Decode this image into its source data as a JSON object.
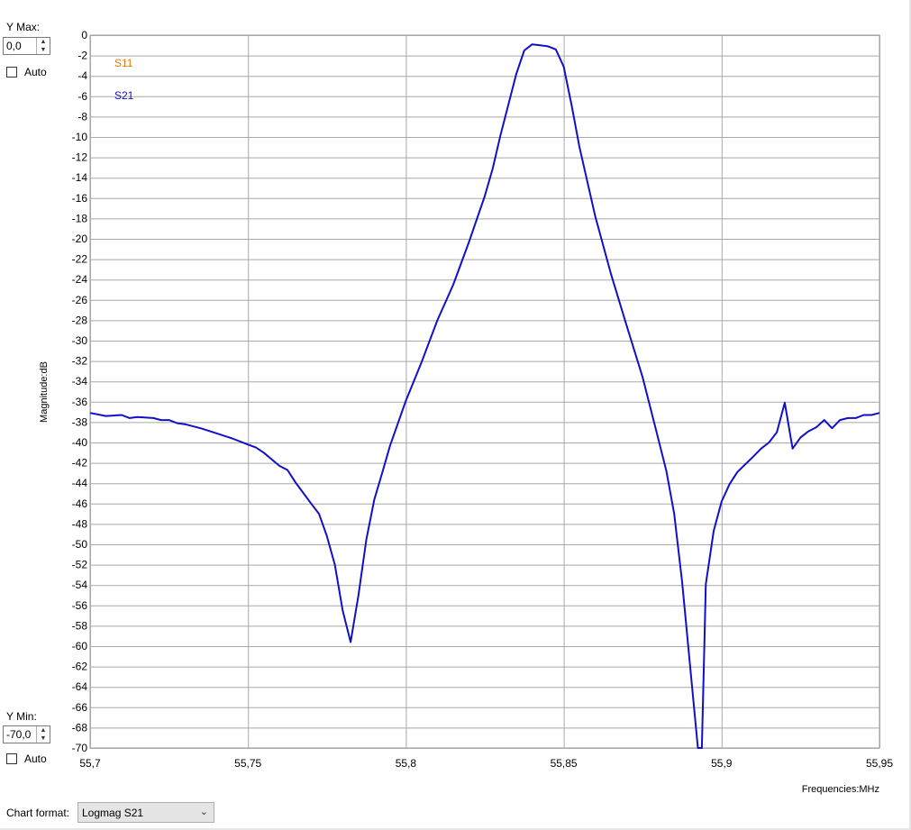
{
  "controls": {
    "ymax_label": "Y Max:",
    "ymax_value": "0,0",
    "ymax_auto_label": "Auto",
    "ymin_label": "Y Min:",
    "ymin_value": "-70,0",
    "ymin_auto_label": "Auto",
    "chart_format_label": "Chart format:",
    "chart_format_value": "Logmag S21"
  },
  "chart_data": {
    "type": "line",
    "xlabel": "Frequencies:MHz",
    "ylabel": "Magnitude:dB",
    "xlim": [
      55.7,
      55.95
    ],
    "ylim": [
      -70,
      0
    ],
    "x_ticks": [
      55.7,
      55.75,
      55.8,
      55.85,
      55.9,
      55.95
    ],
    "x_tick_labels": [
      "55,7",
      "55,75",
      "55,8",
      "55,85",
      "55,9",
      "55,95"
    ],
    "y_ticks": [
      0,
      -2,
      -4,
      -6,
      -8,
      -10,
      -12,
      -14,
      -16,
      -18,
      -20,
      -22,
      -24,
      -26,
      -28,
      -30,
      -32,
      -34,
      -36,
      -38,
      -40,
      -42,
      -44,
      -46,
      -48,
      -50,
      -52,
      -54,
      -56,
      -58,
      -60,
      -62,
      -64,
      -66,
      -68,
      -70
    ],
    "y_tick_labels": [
      "0",
      "-2",
      "-4",
      "-6",
      "-8",
      "-10",
      "-12",
      "-14",
      "-16",
      "-18",
      "-20",
      "-22",
      "-24",
      "-26",
      "-28",
      "-30",
      "-32",
      "-34",
      "-36",
      "-38",
      "-40",
      "-42",
      "-44",
      "-46",
      "-48",
      "-50",
      "-52",
      "-54",
      "-56",
      "-58",
      "-60",
      "-62",
      "-64",
      "-66",
      "-68",
      "-70"
    ],
    "grid": true,
    "legend_position": "top-left",
    "series": [
      {
        "name": "S11",
        "color": "#e07b00",
        "x": [],
        "y": []
      },
      {
        "name": "S21",
        "color": "#1010c8",
        "x": [
          55.7,
          55.705,
          55.71,
          55.7125,
          55.715,
          55.72,
          55.7225,
          55.725,
          55.7275,
          55.73,
          55.735,
          55.74,
          55.745,
          55.75,
          55.7525,
          55.755,
          55.76,
          55.7625,
          55.765,
          55.77,
          55.7725,
          55.775,
          55.7775,
          55.78,
          55.7825,
          55.785,
          55.7875,
          55.79,
          55.7925,
          55.795,
          55.8,
          55.805,
          55.81,
          55.815,
          55.82,
          55.825,
          55.8275,
          55.83,
          55.835,
          55.8375,
          55.84,
          55.8425,
          55.845,
          55.8475,
          55.85,
          55.8525,
          55.855,
          55.86,
          55.865,
          55.87,
          55.875,
          55.88,
          55.8825,
          55.885,
          55.8875,
          55.8925,
          55.89375,
          55.895,
          55.8975,
          55.9,
          55.9025,
          55.905,
          55.91,
          55.9125,
          55.915,
          55.9175,
          55.92,
          55.9225,
          55.925,
          55.9275,
          55.93,
          55.9325,
          55.935,
          55.9375,
          55.94,
          55.9425,
          55.945,
          55.9475,
          55.95
        ],
        "y": [
          -37.1,
          -37.4,
          -37.3,
          -37.6,
          -37.5,
          -37.6,
          -37.8,
          -37.8,
          -38.1,
          -38.2,
          -38.6,
          -39.1,
          -39.6,
          -40.2,
          -40.5,
          -41.0,
          -42.3,
          -42.7,
          -43.9,
          -46.0,
          -47.0,
          -49.2,
          -52.0,
          -56.5,
          -59.6,
          -55.0,
          -49.5,
          -45.6,
          -43.0,
          -40.3,
          -35.9,
          -32.1,
          -28.0,
          -24.5,
          -20.3,
          -15.8,
          -13.1,
          -9.8,
          -3.8,
          -1.5,
          -0.9,
          -1.0,
          -1.1,
          -1.4,
          -3.1,
          -6.9,
          -11.0,
          -17.8,
          -23.5,
          -28.6,
          -33.6,
          -39.7,
          -42.8,
          -47.0,
          -53.7,
          -70.0,
          -70.0,
          -53.9,
          -48.7,
          -45.8,
          -44.1,
          -42.9,
          -41.4,
          -40.6,
          -40.0,
          -39.0,
          -36.1,
          -40.6,
          -39.5,
          -38.9,
          -38.5,
          -37.8,
          -38.6,
          -37.8,
          -37.6,
          -37.6,
          -37.3,
          -37.3,
          -37.1
        ]
      }
    ]
  }
}
